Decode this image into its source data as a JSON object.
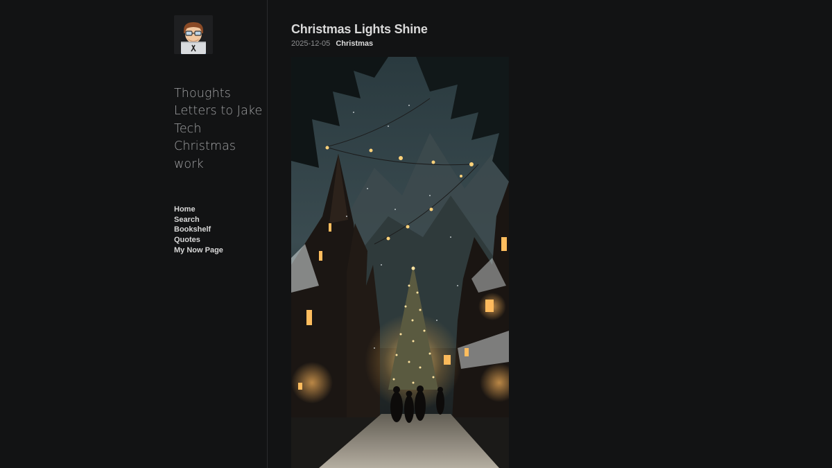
{
  "sidebar": {
    "avatar_icon": "man-with-laptop-emoji-avatar",
    "categories": [
      "Thoughts",
      "Letters to Jake",
      "Tech",
      "Christmas",
      "work"
    ],
    "nav": [
      "Home",
      "Search",
      "Bookshelf",
      "Quotes",
      "My Now Page"
    ]
  },
  "post": {
    "title": "Christmas Lights Shine",
    "date": "2025-12-05",
    "tag": "Christmas",
    "image_icon": "snowy-christmas-village-street-image"
  },
  "colors": {
    "background": "#121314",
    "divider": "#2a2b2d",
    "category_text": "#a3a4a6",
    "nav_text": "#d8d8d8",
    "title_text": "#dadada",
    "date_text": "#8e8f91"
  }
}
